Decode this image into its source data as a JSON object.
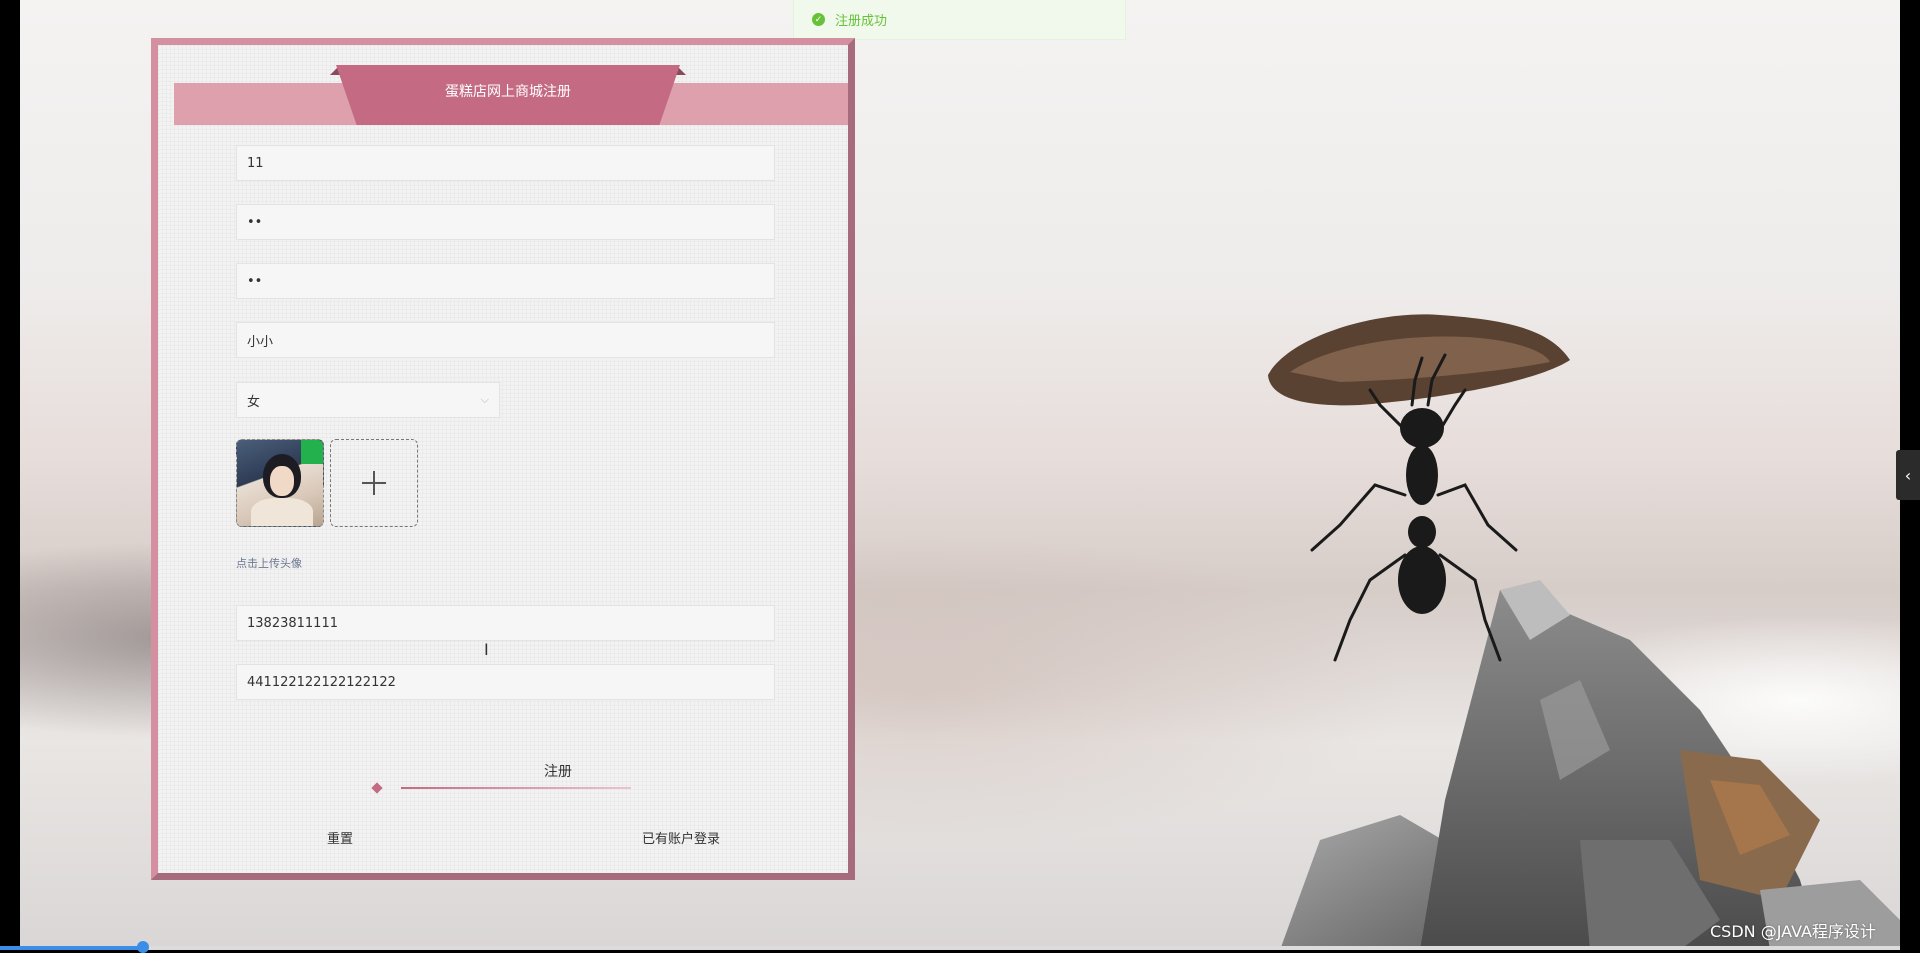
{
  "toast": {
    "message": "注册成功",
    "icon": "success-check-icon",
    "color": "#67c23a"
  },
  "form": {
    "title": "蛋糕店网上商城注册",
    "account": "11",
    "password": "••",
    "confirm_password": "••",
    "name": "小小",
    "gender": "女",
    "avatar_hint": "点击上传头像",
    "phone": "13823811111",
    "id_number": "441122122122122122",
    "register_label": "注册",
    "reset_label": "重置",
    "login_link_label": "已有账户登录"
  },
  "colors": {
    "accent": "#c46a83",
    "panel_border": "#d48fa0",
    "ribbon": "#dfa0ae"
  },
  "watermark": "CSDN @JAVA程序设计",
  "sidebar_toggle_icon": "chevron-left-icon"
}
